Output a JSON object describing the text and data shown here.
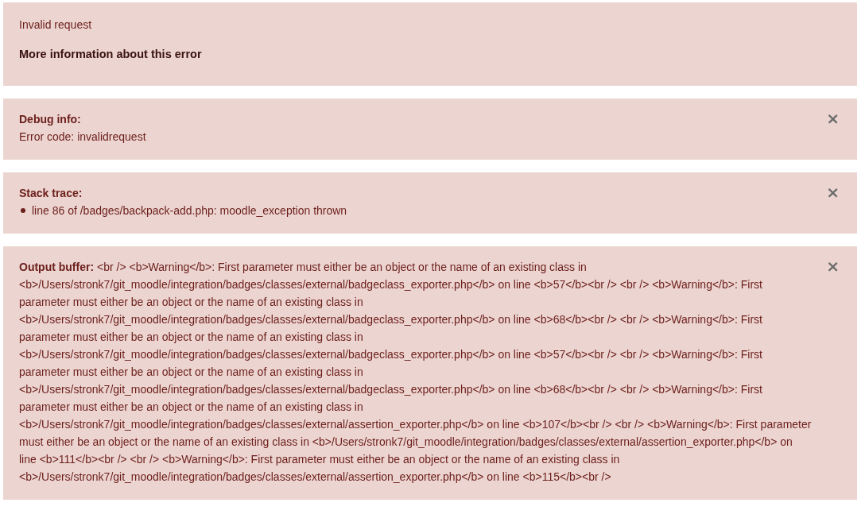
{
  "error_box": {
    "message": "Invalid request",
    "link": "More information about this error"
  },
  "panels": [
    {
      "kind": "debug",
      "title": "Debug info:",
      "body": "Error code: invalidrequest",
      "close": "×"
    },
    {
      "kind": "stack",
      "title": "Stack trace:",
      "items": [
        "line 86 of /badges/backpack-add.php: moodle_exception thrown"
      ],
      "close": "×"
    },
    {
      "kind": "output",
      "text": "**Output buffer:** <br /> <b>Warning</b>: First parameter must either be an object or the name of an existing class in <b>/Users/stronk7/git_moodle/integration/badges/classes/external/badgeclass_exporter.php</b> on line <b>57</b><br /> <br /> <b>Warning</b>: First parameter must either be an object or the name of an existing class in <b>/Users/stronk7/git_moodle/integration/badges/classes/external/badgeclass_exporter.php</b> on line <b>68</b><br /> <br /> <b>Warning</b>: First parameter must either be an object or the name of an existing class in <b>/Users/stronk7/git_moodle/integration/badges/classes/external/badgeclass_exporter.php</b> on line <b>57</b><br /> <br /> <b>Warning</b>: First parameter must either be an object or the name of an existing class in <b>/Users/stronk7/git_moodle/integration/badges/classes/external/badgeclass_exporter.php</b> on line <b>68</b><br /> <br /> <b>Warning</b>: First parameter must either be an object or the name of an existing class in <b>/Users/stronk7/git_moodle/integration/badges/classes/external/assertion_exporter.php</b> on line <b>107</b><br /> <br /> <b>Warning</b>: First parameter must either be an object or the name of an existing class in <b>/Users/stronk7/git_moodle/integration/badges/classes/external/assertion_exporter.php</b> on line <b>111</b><br /> <br /> <b>Warning</b>: First parameter must either be an object or the name of an existing class in <b>/Users/stronk7/git_moodle/integration/badges/classes/external/assertion_exporter.php</b> on line <b>115</b><br />",
      "close": "×"
    }
  ]
}
